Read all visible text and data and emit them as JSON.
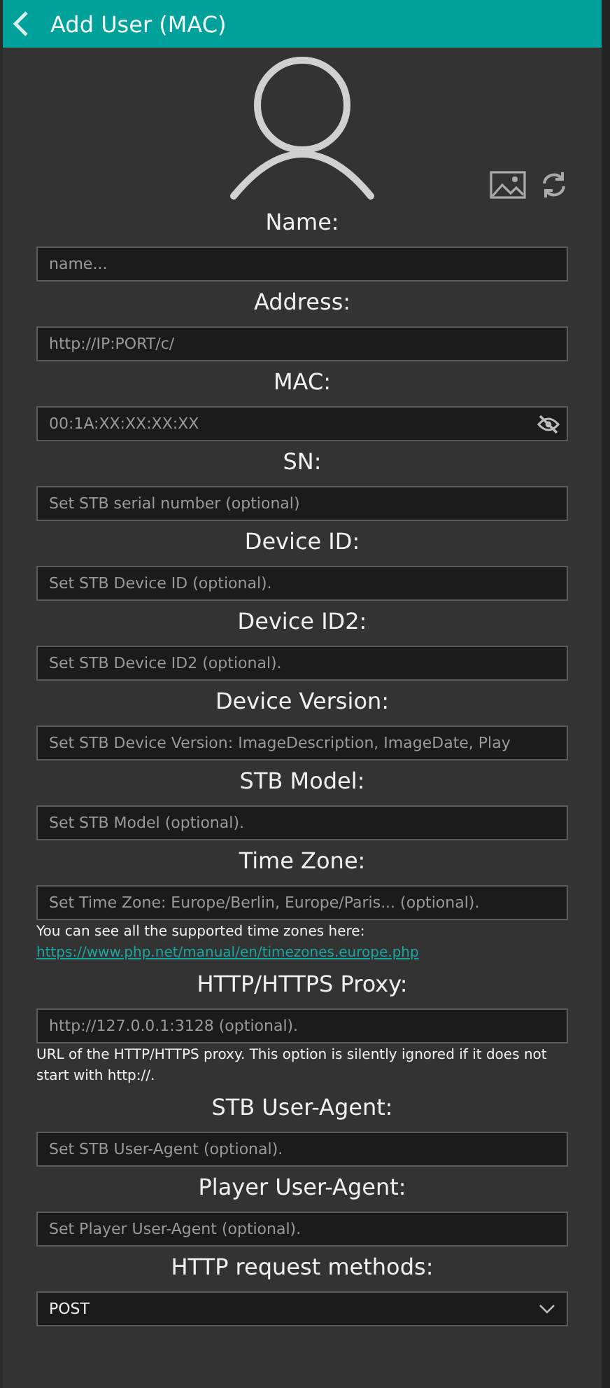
{
  "header": {
    "title": "Add User (MAC)"
  },
  "fields": [
    {
      "kind": "text",
      "label": "Name:",
      "placeholder": "name..."
    },
    {
      "kind": "text",
      "label": "Address:",
      "placeholder": "http://IP:PORT/c/"
    },
    {
      "kind": "password",
      "label": "MAC:",
      "placeholder": "00:1A:XX:XX:XX:XX"
    },
    {
      "kind": "text",
      "label": "SN:",
      "placeholder": "Set STB serial number (optional)"
    },
    {
      "kind": "text",
      "label": "Device ID:",
      "placeholder": "Set STB Device ID (optional)."
    },
    {
      "kind": "text",
      "label": "Device ID2:",
      "placeholder": "Set STB Device ID2 (optional)."
    },
    {
      "kind": "text",
      "label": "Device Version:",
      "placeholder": "Set STB Device Version: ImageDescription, ImageDate, Play"
    },
    {
      "kind": "text",
      "label": "STB Model:",
      "placeholder": "Set STB Model (optional)."
    },
    {
      "kind": "text",
      "label": "Time Zone:",
      "placeholder": "Set Time Zone: Europe/Berlin, Europe/Paris... (optional).",
      "note": "You can see all the supported time zones here:",
      "link": "https://www.php.net/manual/en/timezones.europe.php"
    },
    {
      "kind": "text",
      "label": "HTTP/HTTPS Proxy:",
      "placeholder": "http://127.0.0.1:3128 (optional).",
      "note": "URL of the HTTP/HTTPS proxy. This option is silently ignored if it does not start with http://."
    },
    {
      "kind": "text",
      "label": "STB User-Agent:",
      "placeholder": "Set STB User-Agent (optional)."
    },
    {
      "kind": "text",
      "label": "Player User-Agent:",
      "placeholder": "Set Player User-Agent (optional)."
    },
    {
      "kind": "select",
      "label": "HTTP request methods:",
      "value": "POST"
    }
  ]
}
